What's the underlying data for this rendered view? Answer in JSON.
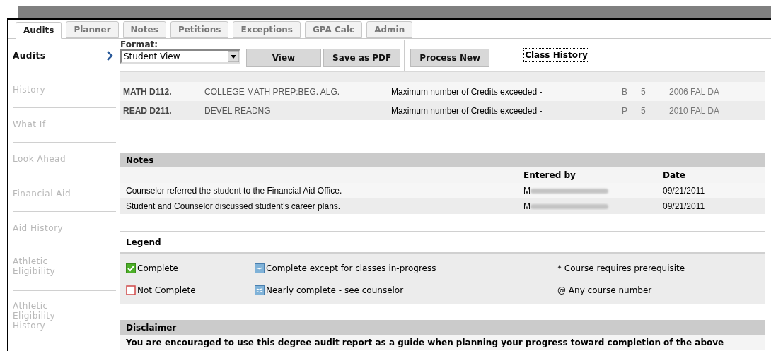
{
  "tabs": [
    {
      "label": "Audits",
      "selected": true
    },
    {
      "label": "Planner",
      "selected": false
    },
    {
      "label": "Notes",
      "selected": false
    },
    {
      "label": "Petitions",
      "selected": false
    },
    {
      "label": "Exceptions",
      "selected": false
    },
    {
      "label": "GPA Calc",
      "selected": false
    },
    {
      "label": "Admin",
      "selected": false
    }
  ],
  "sidebar": {
    "items": [
      {
        "label": "Audits",
        "selected": true
      },
      {
        "label": "History",
        "selected": false
      },
      {
        "label": "What If",
        "selected": false
      },
      {
        "label": "Look Ahead",
        "selected": false
      },
      {
        "label": "Financial Aid",
        "selected": false
      },
      {
        "label": "Aid History",
        "selected": false
      },
      {
        "label": "Athletic Eligibility",
        "selected": false
      },
      {
        "label": "Athletic Eligibility History",
        "selected": false
      }
    ]
  },
  "toolbar": {
    "format_label": "Format:",
    "format_value": "Student View",
    "buttons": [
      "View",
      "Save as PDF",
      "Process New"
    ],
    "link": "Class History"
  },
  "courses": [
    {
      "course": "MATH D112.",
      "title": "COLLEGE MATH PREP:BEG. ALG.",
      "note": "Maximum number of Credits exceeded -",
      "grade": "B",
      "credits": "5",
      "term": "2006 FAL DA"
    },
    {
      "course": "READ D211.",
      "title": "DEVEL READNG",
      "note": "Maximum number of Credits exceeded -",
      "grade": "P",
      "credits": "5",
      "term": "2010 FAL DA"
    }
  ],
  "notes": {
    "title": "Notes",
    "columns": [
      "Entered by",
      "Date"
    ],
    "rows": [
      {
        "text": "Counselor referred the student to the Financial Aid Office.",
        "entered_by": "M",
        "date": "09/21/2011"
      },
      {
        "text": "Student and Counselor discussed student's career plans.",
        "entered_by": "M",
        "date": "09/21/2011"
      }
    ]
  },
  "legend": {
    "title": "Legend",
    "items": [
      {
        "kind": "complete",
        "label": "Complete"
      },
      {
        "kind": "in-progress",
        "label": "Complete except for classes in-progress"
      },
      {
        "kind": "text",
        "label": "* Course requires prerequisite"
      },
      {
        "kind": "not-complete",
        "label": "Not Complete"
      },
      {
        "kind": "nearly",
        "label": "Nearly complete - see counselor"
      },
      {
        "kind": "text",
        "label": "@ Any course number"
      }
    ]
  },
  "disclaimer": {
    "title": "Disclaimer",
    "text": "You are encouraged to use this degree audit report as a guide when planning your progress toward completion of the above"
  }
}
